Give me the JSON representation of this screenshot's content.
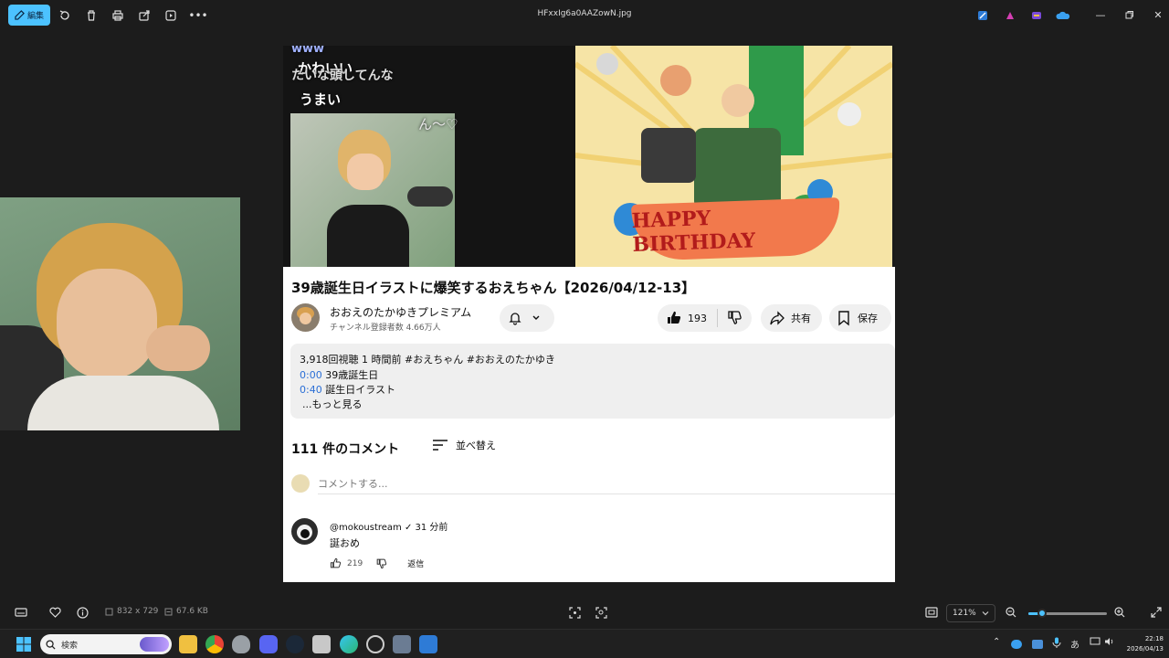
{
  "window": {
    "file_name": "HFxxIg6a0AAZowN.jpg",
    "edit_label": "編集"
  },
  "video": {
    "chat_overlay": [
      "www",
      "かわいい",
      "たいな頭してんな",
      "うまい",
      "ん〜♡"
    ],
    "banner_text": "HAPPY BIRTHDAY",
    "title": "39歳誕生日イラストに爆笑するおえちゃん【2026/04/12-13】",
    "channel_name": "おおえのたかゆきプレミアム",
    "subscribers": "チャンネル登録者数 4.66万人",
    "likes": "193",
    "share_label": "共有",
    "save_label": "保存"
  },
  "description": {
    "meta": "3,918回視聴  1 時間前  #おえちゃん #おおえのたかゆき",
    "chapters": [
      {
        "time": "0:00",
        "label": "39歳誕生日"
      },
      {
        "time": "0:40",
        "label": "誕生日イラスト"
      }
    ],
    "more": "...もっと見る"
  },
  "comments": {
    "header": "111 件のコメント",
    "sort_label": "並べ替え",
    "input_placeholder": "コメントする...",
    "items": [
      {
        "user": "@mokoustream ✓ 31 分前",
        "text": "誕おめ",
        "likes": "219",
        "reply": "返信"
      }
    ]
  },
  "viewer_bar": {
    "dimensions": "832 x 729",
    "file_size": "67.6 KB",
    "zoom": "121%",
    "zoom_slider_fraction": 0.18
  },
  "taskbar": {
    "search_placeholder": "検索",
    "ime": "あ",
    "time": "22:18",
    "date": "2026/04/13"
  },
  "colors": {
    "accent": "#4cc2ff",
    "link": "#2b6fd6"
  }
}
